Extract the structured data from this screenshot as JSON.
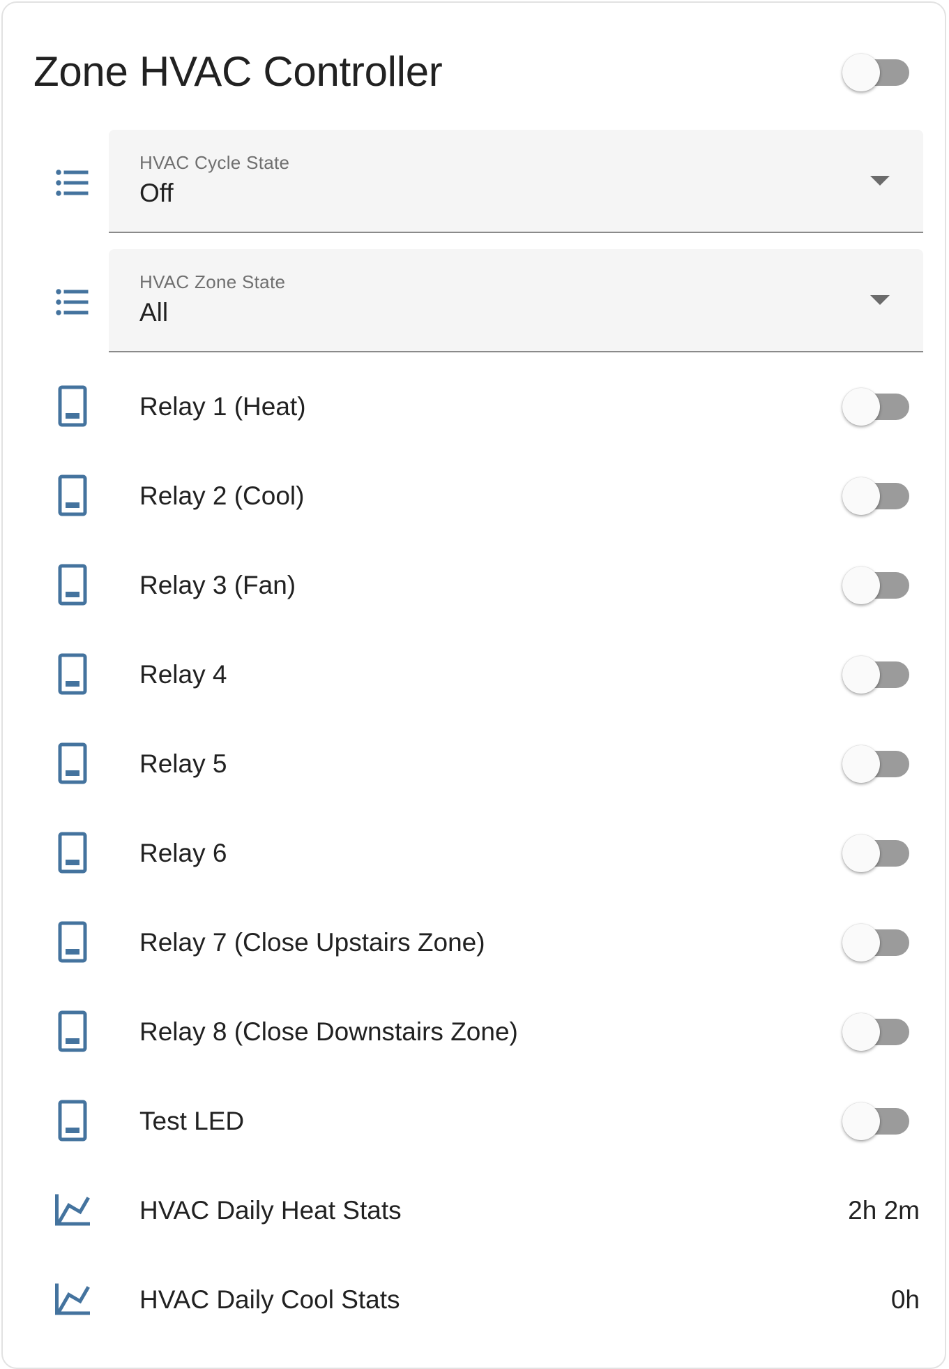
{
  "card": {
    "title": "Zone HVAC Controller",
    "master_toggle_on": false
  },
  "colors": {
    "icon": "#44739e",
    "toggle_track_off": "#9b9b9b",
    "toggle_thumb_off": "#fafafa",
    "text": "#212121",
    "select_bg": "#f5f5f5"
  },
  "selects": [
    {
      "icon": "format-list-bulleted-icon",
      "label": "HVAC Cycle State",
      "value": "Off"
    },
    {
      "icon": "format-list-bulleted-icon",
      "label": "HVAC Zone State",
      "value": "All"
    }
  ],
  "switches": [
    {
      "icon": "tablet-icon",
      "label": "Relay 1 (Heat)",
      "on": false
    },
    {
      "icon": "tablet-icon",
      "label": "Relay 2 (Cool)",
      "on": false
    },
    {
      "icon": "tablet-icon",
      "label": "Relay 3 (Fan)",
      "on": false
    },
    {
      "icon": "tablet-icon",
      "label": "Relay 4",
      "on": false
    },
    {
      "icon": "tablet-icon",
      "label": "Relay 5",
      "on": false
    },
    {
      "icon": "tablet-icon",
      "label": "Relay 6",
      "on": false
    },
    {
      "icon": "tablet-icon",
      "label": "Relay 7 (Close Upstairs Zone)",
      "on": false
    },
    {
      "icon": "tablet-icon",
      "label": "Relay 8 (Close Downstairs Zone)",
      "on": false
    },
    {
      "icon": "tablet-icon",
      "label": "Test LED",
      "on": false
    }
  ],
  "sensors": [
    {
      "icon": "chart-line-icon",
      "label": "HVAC Daily Heat Stats",
      "value": "2h 2m"
    },
    {
      "icon": "chart-line-icon",
      "label": "HVAC Daily Cool Stats",
      "value": "0h"
    }
  ]
}
